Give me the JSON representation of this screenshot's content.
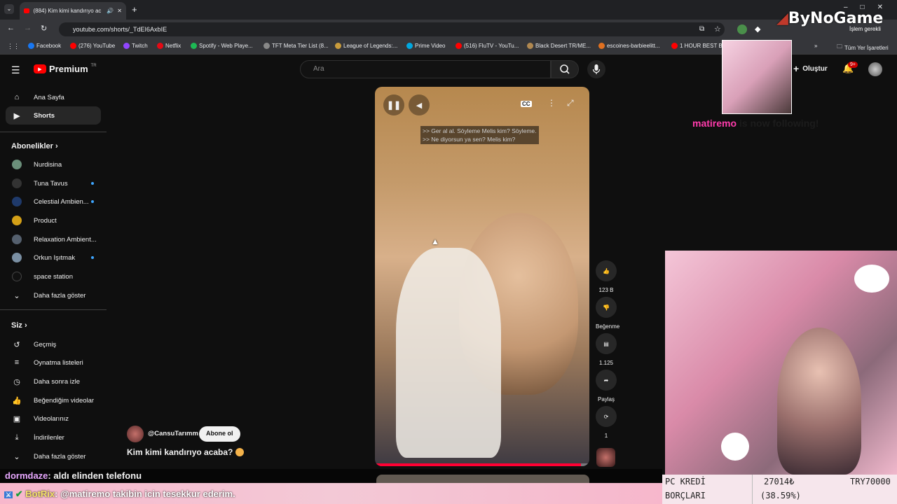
{
  "browser": {
    "tab_title": "(884) Kim kimi kandırıyo ac",
    "url": "youtube.com/shorts/_TdEI6AxbIE",
    "bookmarks": [
      "Facebook",
      "(276) YouTube",
      "Twitch",
      "Netflix",
      "Spotify - Web Playe...",
      "TFT Meta Tier List (8...",
      "League of Legends:...",
      "Prime Video",
      "(516) FluTV - YouTu...",
      "Black Desert TR/ME...",
      "escoines-barbieelitt...",
      "1 HOUR BEST BI"
    ],
    "other_bookmarks": "Tüm Yer İşaretleri",
    "profile_label": "İşlem gerekli"
  },
  "youtube": {
    "logo": "Premium",
    "logo_sup": "TR",
    "search_placeholder": "Ara",
    "create_label": "Oluştur",
    "notif_badge": "9+"
  },
  "sidebar": {
    "main": [
      {
        "label": "Ana Sayfa",
        "icon": "home-icon"
      },
      {
        "label": "Shorts",
        "icon": "shorts-icon"
      }
    ],
    "subs_header": "Abonelikler",
    "subs": [
      {
        "label": "Nurdisina",
        "color": "#6b8f7a"
      },
      {
        "label": "Tuna Tavus",
        "color": "#333333"
      },
      {
        "label": "Celestial Ambien...",
        "color": "#1f3a6b"
      },
      {
        "label": "Product",
        "color": "#d4a017"
      },
      {
        "label": "Relaxation Ambient...",
        "color": "#55606e"
      },
      {
        "label": "Orkun Işıtmak",
        "color": "#7a8fa3"
      },
      {
        "label": "space station",
        "color": "#111111"
      }
    ],
    "subs_more": "Daha fazla göster",
    "you_header": "Siz",
    "you": [
      {
        "label": "Geçmiş",
        "icon": "history-icon"
      },
      {
        "label": "Oynatma listeleri",
        "icon": "playlists-icon"
      },
      {
        "label": "Daha sonra izle",
        "icon": "watch-later-icon"
      },
      {
        "label": "Beğendiğim videolar",
        "icon": "liked-icon"
      },
      {
        "label": "Videolarınız",
        "icon": "your-videos-icon"
      },
      {
        "label": "İndirilenler",
        "icon": "downloads-icon"
      }
    ],
    "you_more": "Daha fazla göster"
  },
  "short": {
    "captions": [
      ">> Ger al al. Söyleme Melis kim? Söyleme.",
      ">> Ne diyorsun ya sen? Melis kim?"
    ],
    "channel": "@CansuTarımm",
    "subscribe": "Abone ol",
    "title": "Kim kimi kandırıyo acaba?",
    "likes": "123 B",
    "dislike_label": "Beğenme",
    "comments": "1.125",
    "share_label": "Paylaş",
    "remix_count": "1"
  },
  "stream_overlay": {
    "watermark": "ByNoGame",
    "follow_user": "matiremo",
    "follow_text": "is now following!",
    "chat": [
      {
        "user": "dormdaze",
        "text": ": aldı elinden telefonu"
      },
      {
        "user": "BotRix",
        "text": ": @matiremo takibin icin tesekkur ederim."
      }
    ],
    "credit": {
      "label1": "PC KREDİ",
      "label2": "BORÇLARI",
      "amount": "27014₺",
      "percent": "(38.59%)",
      "goal": "TRY70000"
    }
  }
}
